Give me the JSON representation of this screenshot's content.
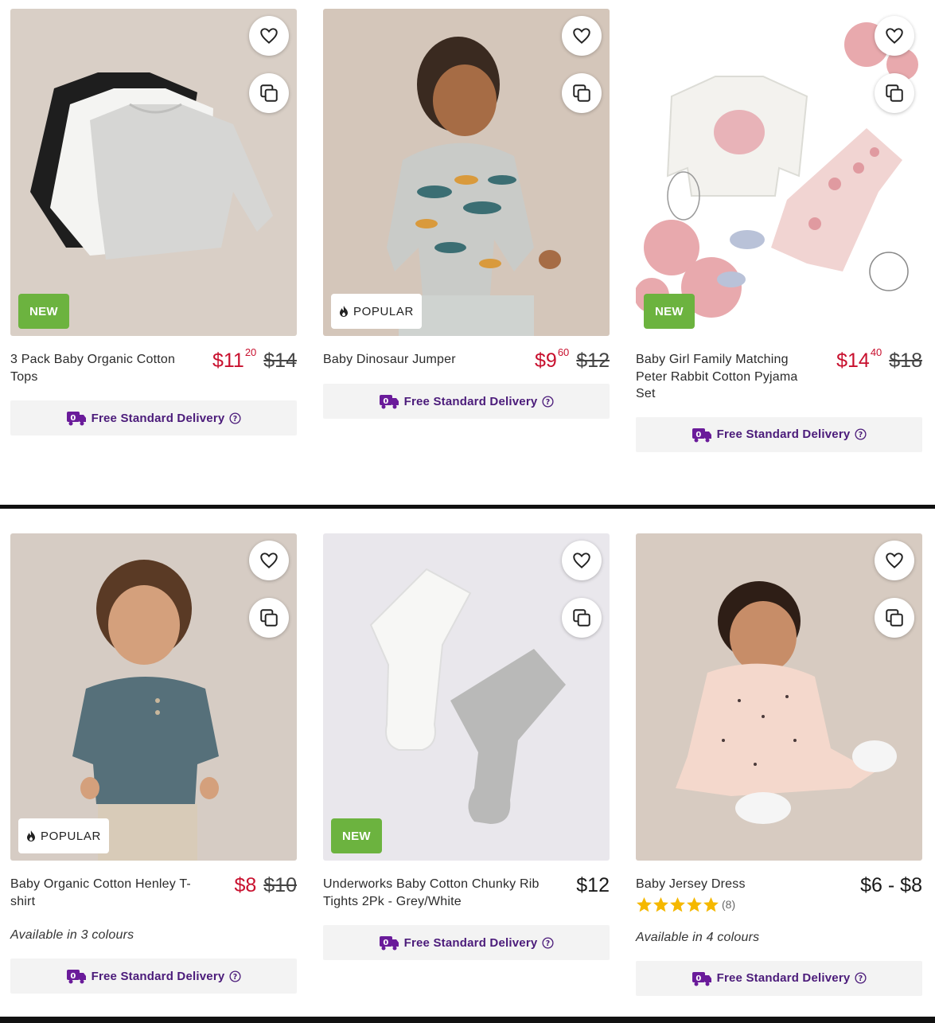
{
  "products": [
    {
      "title": "3 Pack Baby Organic Cotton Tops",
      "badge": "NEW",
      "price_dollars": "$11",
      "price_cents": "20",
      "was_price": "$14",
      "delivery": "Free Standard Delivery"
    },
    {
      "title": "Baby Dinosaur Jumper",
      "badge": "POPULAR",
      "price_dollars": "$9",
      "price_cents": "60",
      "was_price": "$12",
      "delivery": "Free Standard Delivery"
    },
    {
      "title": "Baby Girl Family Matching Peter Rabbit Cotton Pyjama Set",
      "badge": "NEW",
      "price_dollars": "$14",
      "price_cents": "40",
      "was_price": "$18",
      "delivery": "Free Standard Delivery"
    },
    {
      "title": "Baby Organic Cotton Henley T-shirt",
      "badge": "POPULAR",
      "price": "$8",
      "was_price": "$10",
      "availability": "Available in 3 colours",
      "delivery": "Free Standard Delivery"
    },
    {
      "title": "Underworks Baby Cotton Chunky Rib Tights 2Pk - Grey/White",
      "badge": "NEW",
      "price": "$12",
      "delivery": "Free Standard Delivery"
    },
    {
      "title": "Baby Jersey Dress",
      "price": "$6 - $8",
      "rating": 5,
      "review_count": "(8)",
      "availability": "Available in 4 colours",
      "delivery": "Free Standard Delivery"
    }
  ],
  "colors": {
    "sale_price": "#c8102e",
    "badge_new": "#6cb33f",
    "delivery_text": "#4b1b7a",
    "star": "#f5b800"
  },
  "icons": [
    "heart-icon",
    "compare-icon",
    "flame-icon",
    "truck-icon",
    "help-icon",
    "star-icon"
  ]
}
